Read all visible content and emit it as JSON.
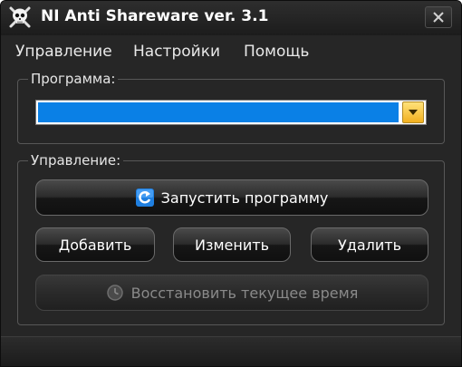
{
  "window": {
    "title": "NI Anti Shareware ver. 3.1"
  },
  "menu": {
    "items": [
      {
        "label": "Управление"
      },
      {
        "label": "Настройки"
      },
      {
        "label": "Помощь"
      }
    ]
  },
  "program_group": {
    "label": "Программа:",
    "combo_value": ""
  },
  "control_group": {
    "label": "Управление:",
    "run_label": "Запустить программу",
    "add_label": "Добавить",
    "edit_label": "Изменить",
    "delete_label": "Удалить",
    "restore_label": "Восстановить текущее время"
  },
  "colors": {
    "window_bg": "#262626",
    "selection_blue": "#0a80e6",
    "dropdown_gold": "#f2b020"
  },
  "icons": {
    "app": "skull-icon",
    "close": "close-icon",
    "dropdown": "chevron-down-icon",
    "run": "refresh-run-icon",
    "restore": "clock-icon"
  }
}
